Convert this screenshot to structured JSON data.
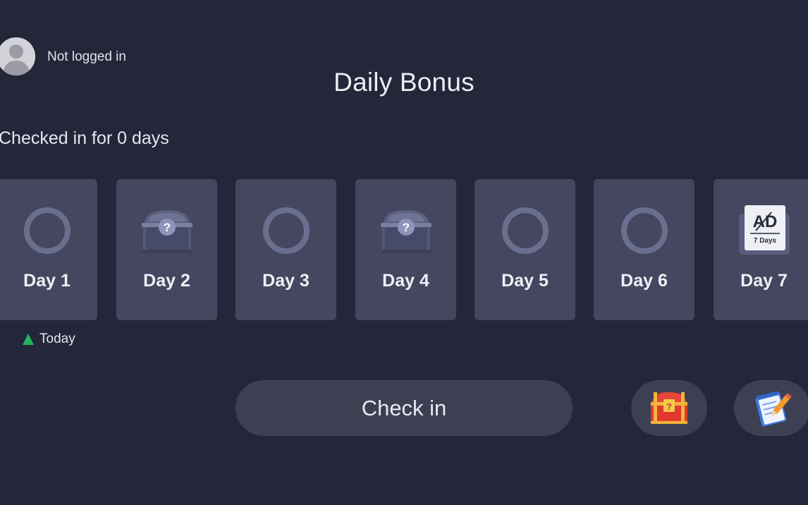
{
  "header": {
    "login_status": "Not logged in",
    "title": "Daily Bonus"
  },
  "streak": {
    "text": "Checked in for 0 days"
  },
  "days": [
    {
      "label": "Day 1",
      "icon": "ring-icon"
    },
    {
      "label": "Day 2",
      "icon": "mystery-chest-icon"
    },
    {
      "label": "Day 3",
      "icon": "ring-icon"
    },
    {
      "label": "Day 4",
      "icon": "mystery-chest-icon"
    },
    {
      "label": "Day 5",
      "icon": "ring-icon"
    },
    {
      "label": "Day 6",
      "icon": "ring-icon"
    },
    {
      "label": "Day 7",
      "icon": "ad-free-7days-icon",
      "badge_text": "7 Days",
      "badge_main": "AD"
    }
  ],
  "today": {
    "label": "Today",
    "color": "#22b35a"
  },
  "actions": {
    "checkin_label": "Check in",
    "chest_icon": "red-treasure-chest-icon",
    "notes_icon": "notepad-pen-icon"
  },
  "colors": {
    "background": "#24263a",
    "card": "#44475f",
    "button": "#3d3f52"
  }
}
